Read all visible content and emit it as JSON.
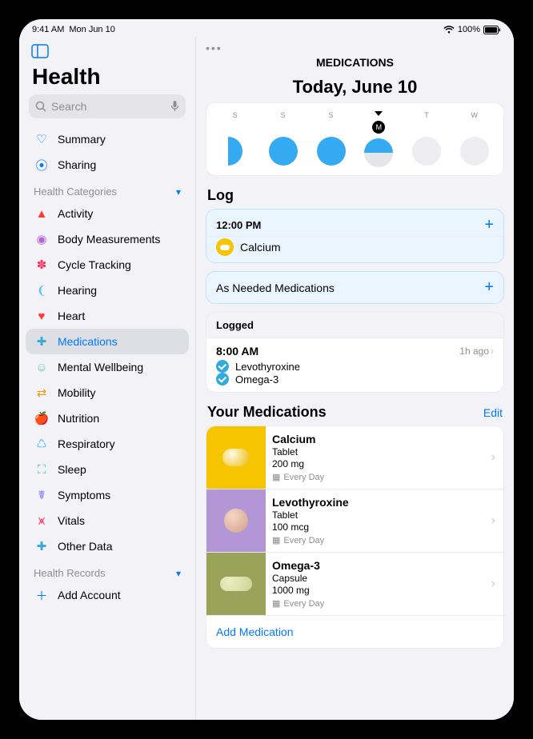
{
  "status": {
    "time": "9:41 AM",
    "date": "Mon Jun 10",
    "battery": "100%"
  },
  "app": {
    "title": "Health",
    "toggle_icon": "sidebar"
  },
  "search": {
    "placeholder": "Search"
  },
  "sidebar": {
    "top": [
      {
        "label": "Summary",
        "color": "#007aff",
        "glyph": "♡"
      },
      {
        "label": "Sharing",
        "color": "#007aff",
        "glyph": "⦿"
      }
    ],
    "categories_header": "Health Categories",
    "categories": [
      {
        "label": "Activity",
        "color": "#ff3b30",
        "glyph": "▲"
      },
      {
        "label": "Body Measurements",
        "color": "#b565d9",
        "glyph": "◉"
      },
      {
        "label": "Cycle Tracking",
        "color": "#ff2d55",
        "glyph": "✽"
      },
      {
        "label": "Hearing",
        "color": "#5ac8fa",
        "glyph": "❨"
      },
      {
        "label": "Heart",
        "color": "#ff3b30",
        "glyph": "♥"
      },
      {
        "label": "Medications",
        "color": "#34aadc",
        "glyph": "✚",
        "selected": true
      },
      {
        "label": "Mental Wellbeing",
        "color": "#5fd3bc",
        "glyph": "☺"
      },
      {
        "label": "Mobility",
        "color": "#ff9500",
        "glyph": "⇄"
      },
      {
        "label": "Nutrition",
        "color": "#4cd964",
        "glyph": "🍎"
      },
      {
        "label": "Respiratory",
        "color": "#5ac8fa",
        "glyph": "♺"
      },
      {
        "label": "Sleep",
        "color": "#30d0bd",
        "glyph": "⛶"
      },
      {
        "label": "Symptoms",
        "color": "#7a6fff",
        "glyph": "☤"
      },
      {
        "label": "Vitals",
        "color": "#ff2d55",
        "glyph": "⩙"
      },
      {
        "label": "Other Data",
        "color": "#34aadc",
        "glyph": "✚"
      }
    ],
    "records_header": "Health Records",
    "records": [
      {
        "label": "Add Account",
        "color": "#007aff",
        "glyph": "＋"
      }
    ]
  },
  "main": {
    "title": "MEDICATIONS",
    "date_title": "Today, June 10",
    "week": [
      {
        "label": "S",
        "state": "cut"
      },
      {
        "label": "S",
        "state": "full"
      },
      {
        "label": "S",
        "state": "full"
      },
      {
        "label": "M",
        "state": "half",
        "today": true
      },
      {
        "label": "T",
        "state": "empty"
      },
      {
        "label": "W",
        "state": "empty"
      }
    ],
    "log_header": "Log",
    "log_time": "12:00 PM",
    "log_med": "Calcium",
    "as_needed": "As Needed Medications",
    "logged_header": "Logged",
    "logged_time": "8:00 AM",
    "logged_ago": "1h ago",
    "logged_meds": [
      "Levothyroxine",
      "Omega-3"
    ],
    "your_meds_header": "Your Medications",
    "edit": "Edit",
    "meds": [
      {
        "name": "Calcium",
        "form": "Tablet",
        "dose": "200 mg",
        "sched": "Every Day",
        "bg": "yellow"
      },
      {
        "name": "Levothyroxine",
        "form": "Tablet",
        "dose": "100 mcg",
        "sched": "Every Day",
        "bg": "purple"
      },
      {
        "name": "Omega-3",
        "form": "Capsule",
        "dose": "1000 mg",
        "sched": "Every Day",
        "bg": "olive"
      }
    ],
    "add_med": "Add Medication"
  }
}
